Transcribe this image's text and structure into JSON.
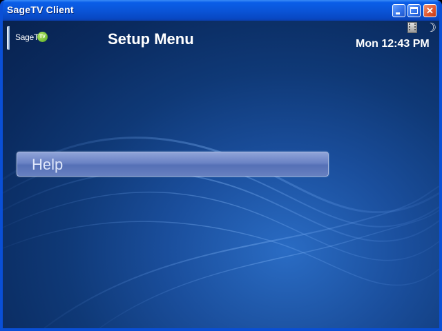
{
  "window": {
    "title": "SageTV Client"
  },
  "titlebar_buttons": {
    "minimize": "minimize",
    "maximize": "maximize",
    "close": "close"
  },
  "header": {
    "logo_text": "SageTV",
    "logo_badge": "TV",
    "page_title": "Setup Menu",
    "clock": "Mon  12:43 PM"
  },
  "status_icons": [
    "film-icon",
    "moon-icon"
  ],
  "menu": {
    "items": [
      {
        "label": "Help",
        "selected": true
      }
    ]
  },
  "colors": {
    "titlebar": "#0a55d8",
    "background": "#0f3977",
    "menu_highlight": "#6a82c4",
    "close_button": "#e0542c"
  }
}
